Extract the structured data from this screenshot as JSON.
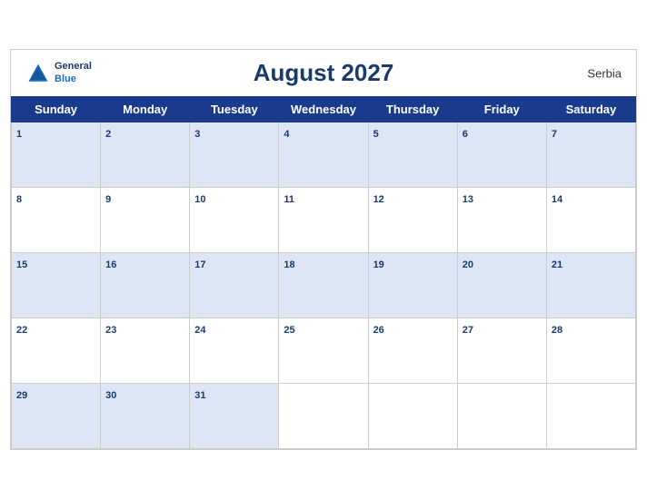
{
  "header": {
    "title": "August 2027",
    "country": "Serbia",
    "logo": {
      "line1": "General",
      "line2": "Blue"
    }
  },
  "weekdays": [
    "Sunday",
    "Monday",
    "Tuesday",
    "Wednesday",
    "Thursday",
    "Friday",
    "Saturday"
  ],
  "weeks": [
    [
      1,
      2,
      3,
      4,
      5,
      6,
      7
    ],
    [
      8,
      9,
      10,
      11,
      12,
      13,
      14
    ],
    [
      15,
      16,
      17,
      18,
      19,
      20,
      21
    ],
    [
      22,
      23,
      24,
      25,
      26,
      27,
      28
    ],
    [
      29,
      30,
      31,
      null,
      null,
      null,
      null
    ]
  ],
  "colors": {
    "header_bg": "#1a3a8c",
    "row_odd": "#dce6f5",
    "row_even": "#ffffff",
    "day_color": "#1a3a6b"
  }
}
